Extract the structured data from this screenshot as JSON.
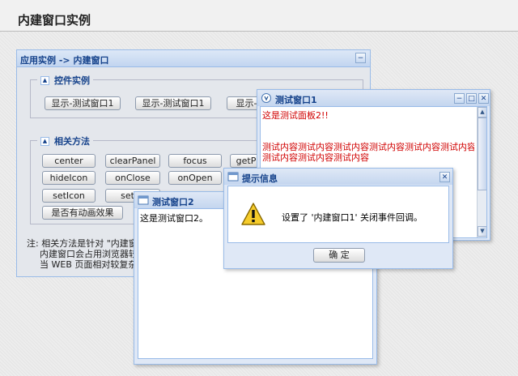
{
  "page": {
    "title": "内建窗口实例"
  },
  "main_panel": {
    "title": "应用实例 -> 内建窗口",
    "controls_section": {
      "legend": "控件实例",
      "buttons": [
        "显示-测试窗口1",
        "显示-测试窗口1",
        "显示-测"
      ]
    },
    "methods_section": {
      "legend": "相关方法",
      "buttons": [
        "center",
        "clearPanel",
        "focus",
        "getP",
        "hideIcon",
        "onClose",
        "onOpen",
        "setIcon",
        "setPa",
        "是否有动画效果"
      ]
    },
    "note_lines": [
      "注: 相关方法是针对 \"内建窗口",
      "内建窗口会占用浏览器较",
      "当 WEB 页面相对较复杂"
    ]
  },
  "window1": {
    "title": "测试窗口1",
    "line1": "这是测试面板2!!",
    "line2": "测试内容测试内容测试内容测试内容测试内容测试内容测试内",
    "line3": "测试内容测试内容测试内容"
  },
  "window2": {
    "title": "测试窗口2",
    "content": "这是测试窗口2。"
  },
  "message_box": {
    "title": "提示信息",
    "message": "设置了 '内建窗口1' 关闭事件回调。",
    "ok_label": "确 定"
  },
  "colors": {
    "title_text": "#15428b",
    "border": "#99bbe8",
    "red_text": "#d00000"
  },
  "icons": [
    "collapse-icon",
    "minimize-icon",
    "maximize-icon",
    "close-icon",
    "window-icon",
    "warning-icon"
  ]
}
